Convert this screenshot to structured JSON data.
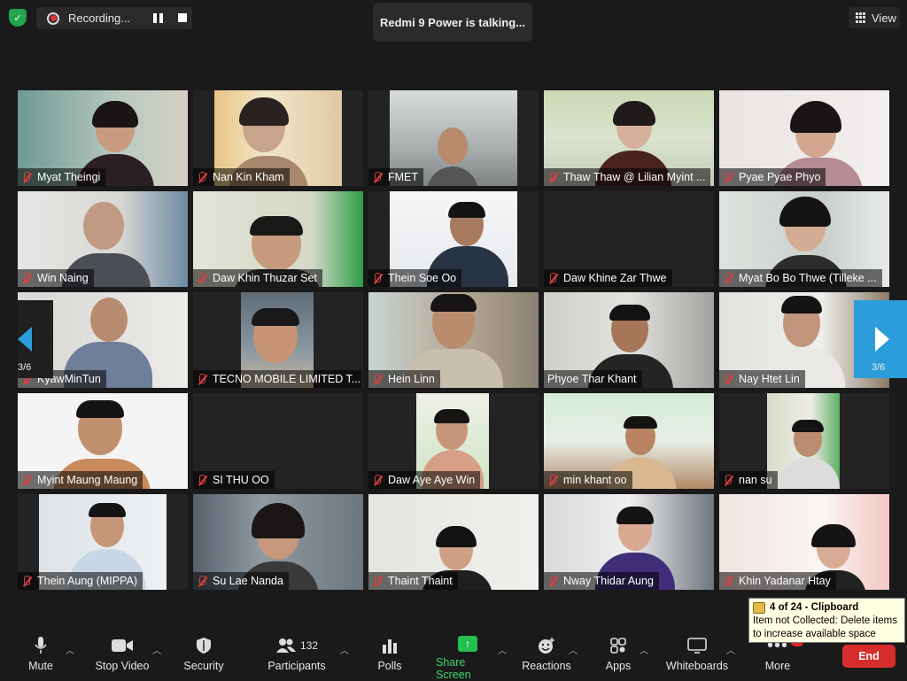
{
  "top": {
    "recording_label": "Recording...",
    "talking": "Redmi 9 Power is talking...",
    "view_label": "View"
  },
  "participants": [
    {
      "name": "Myat Theingi"
    },
    {
      "name": "Nan Kin Kham"
    },
    {
      "name": "FMET"
    },
    {
      "name": "Thaw Thaw @ Lilian Myint ..."
    },
    {
      "name": "Pyae Pyae Phyo"
    },
    {
      "name": "Win Naing"
    },
    {
      "name": "Daw Khin Thuzar Set"
    },
    {
      "name": "Thein Soe Oo"
    },
    {
      "name": "Daw Khine Zar Thwe"
    },
    {
      "name": "Myat Bo Bo Thwe (Tilleke ..."
    },
    {
      "name": "KyawMinTun"
    },
    {
      "name": "TECNO MOBILE LIMITED T..."
    },
    {
      "name": "Hein Linn"
    },
    {
      "name": "Phyoe Thar Khant"
    },
    {
      "name": "Nay Htet Lin"
    },
    {
      "name": "Myint Maung Maung"
    },
    {
      "name": "SI THU OO"
    },
    {
      "name": "Daw Aye Aye Win"
    },
    {
      "name": "min khant oo"
    },
    {
      "name": "nan su"
    },
    {
      "name": "Thein  Aung (MIPPA)"
    },
    {
      "name": "Su Lae Nanda"
    },
    {
      "name": "Thaint Thaint"
    },
    {
      "name": "Nway Thidar Aung"
    },
    {
      "name": "Khin Yadanar Htay"
    }
  ],
  "nav": {
    "left_page": "3/6",
    "right_page": "3/6"
  },
  "toolbar": {
    "mute": "Mute",
    "stop_video": "Stop Video",
    "security": "Security",
    "participants": "Participants",
    "participants_count": "132",
    "polls": "Polls",
    "share_screen": "Share Screen",
    "reactions": "Reactions",
    "apps": "Apps",
    "whiteboards": "Whiteboards",
    "more": "More",
    "end": "End"
  },
  "tooltip": {
    "title": "4 of 24 - Clipboard",
    "line1": "Item not Collected: Delete items",
    "line2": "to increase available space"
  },
  "colors": {
    "accent": "#2a9dda",
    "share": "#23c050",
    "end": "#d72c2c",
    "muted_mic": "#e03e3e"
  }
}
